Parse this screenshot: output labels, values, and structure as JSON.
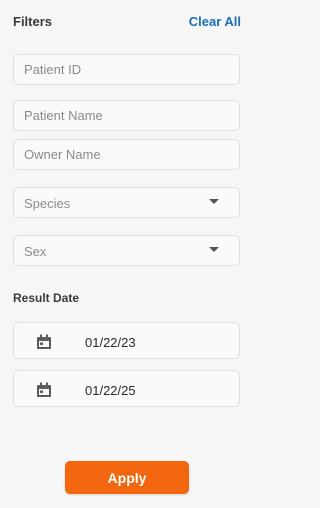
{
  "filters": {
    "title": "Filters",
    "clear_all_label": "Clear All",
    "patient_id_placeholder": "Patient ID",
    "patient_name_placeholder": "Patient Name",
    "owner_name_placeholder": "Owner Name",
    "species_label": "Species",
    "sex_label": "Sex",
    "result_date_label": "Result Date",
    "date_from": "01/22/23",
    "date_to": "01/22/25",
    "apply_label": "Apply"
  },
  "colors": {
    "accent_blue": "#1a6fb5",
    "apply_orange": "#f2660f"
  },
  "icons": {
    "dropdown": "chevron-down-icon",
    "date": "calendar-icon"
  }
}
